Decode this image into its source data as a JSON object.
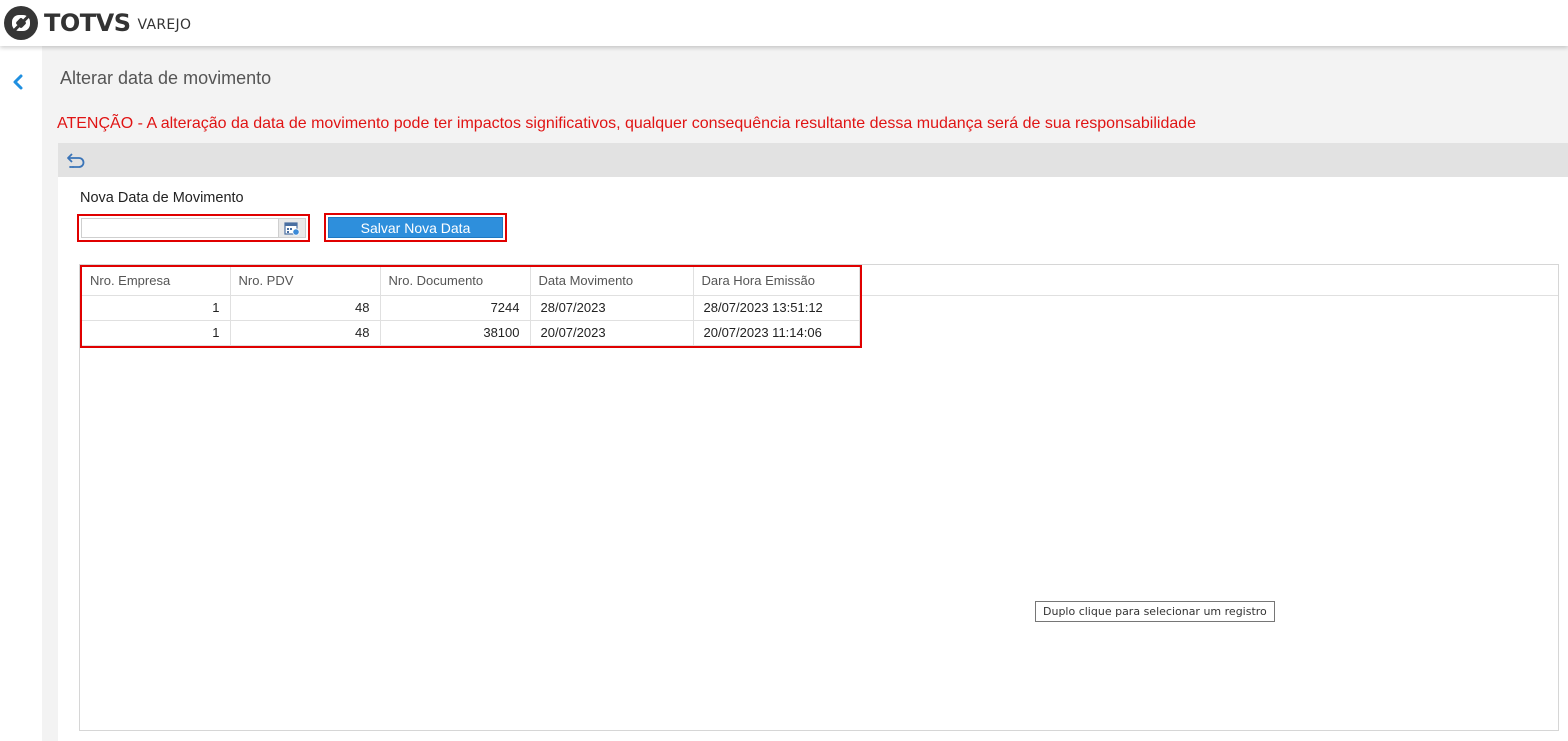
{
  "header": {
    "brand": "TOTVS",
    "product": "VAREJO"
  },
  "page": {
    "title": "Alterar data de movimento",
    "warning": "ATENÇÃO - A alteração da data de movimento pode ter impactos significativos, qualquer consequência resultante dessa mudança será de sua responsabilidade"
  },
  "form": {
    "date_label": "Nova Data de Movimento",
    "date_value": "",
    "save_label": "Salvar Nova Data"
  },
  "grid": {
    "columns": [
      "Nro. Empresa",
      "Nro. PDV",
      "Nro. Documento",
      "Data Movimento",
      "Dara Hora Emissão"
    ],
    "rows": [
      [
        "1",
        "48",
        "7244",
        "28/07/2023",
        "28/07/2023 13:51:12"
      ],
      [
        "1",
        "48",
        "38100",
        "20/07/2023",
        "20/07/2023 11:14:06"
      ]
    ]
  },
  "tooltip": "Duplo clique para selecionar um registro",
  "colors": {
    "accent": "#2e8fdc",
    "warning": "#e01414",
    "highlight": "#e00000"
  },
  "icons": {
    "logo": "totvs-logo-icon",
    "back": "chevron-left-icon",
    "undo": "undo-icon",
    "calendar": "calendar-icon"
  }
}
